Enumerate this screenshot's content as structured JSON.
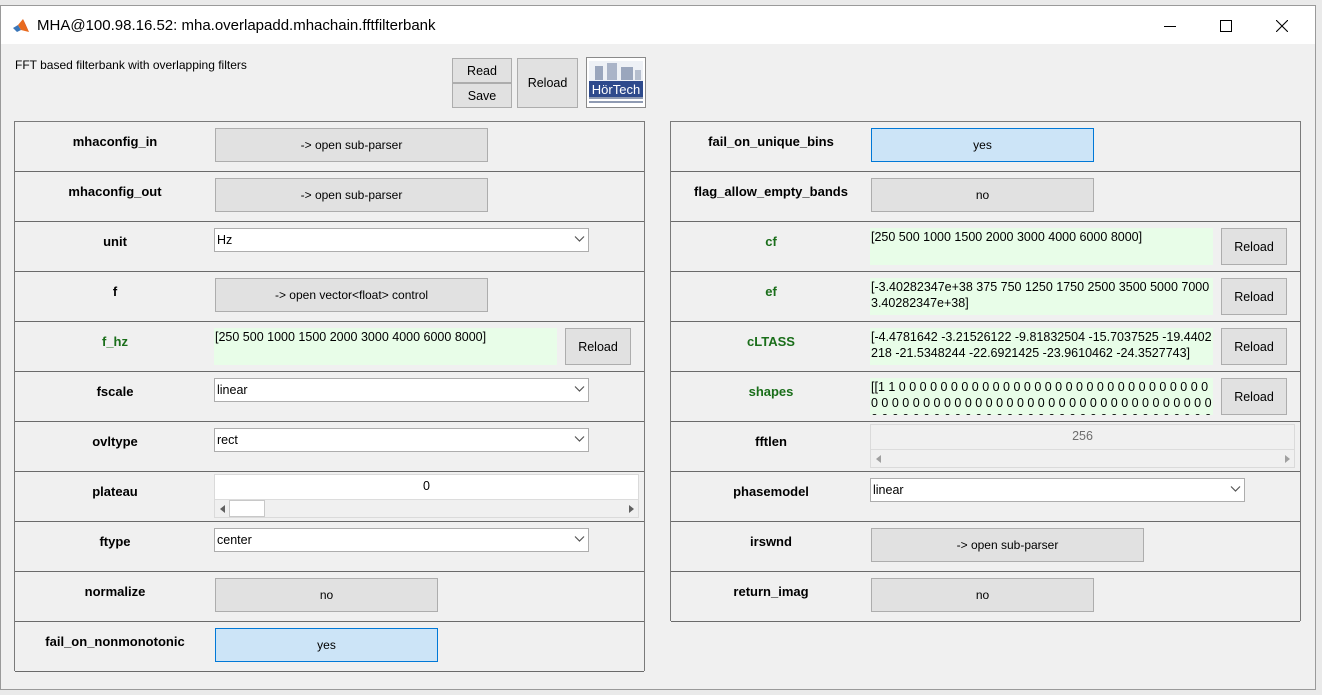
{
  "window": {
    "title": "MHA@100.98.16.52: mha.overlapadd.mhachain.fftfilterbank"
  },
  "header": {
    "description": "FFT based filterbank with overlapping filters",
    "read_label": "Read",
    "save_label": "Save",
    "reload_label": "Reload",
    "logo_text": "HörTech"
  },
  "left": {
    "mhaconfig_in": {
      "label": "mhaconfig_in",
      "button": "-> open sub-parser"
    },
    "mhaconfig_out": {
      "label": "mhaconfig_out",
      "button": "-> open sub-parser"
    },
    "unit": {
      "label": "unit",
      "value": "Hz"
    },
    "f": {
      "label": "f",
      "button": "-> open vector<float> control"
    },
    "f_hz": {
      "label": "f_hz",
      "value": "[250 500 1000 1500 2000 3000 4000 6000 8000]",
      "reload": "Reload"
    },
    "fscale": {
      "label": "fscale",
      "value": "linear"
    },
    "ovltype": {
      "label": "ovltype",
      "value": "rect"
    },
    "plateau": {
      "label": "plateau",
      "value": "0"
    },
    "ftype": {
      "label": "ftype",
      "value": "center"
    },
    "normalize": {
      "label": "normalize",
      "button": "no"
    },
    "fail_on_nonmonotonic": {
      "label": "fail_on_nonmonotonic",
      "button": "yes"
    }
  },
  "right": {
    "fail_on_unique_bins": {
      "label": "fail_on_unique_bins",
      "button": "yes"
    },
    "flag_allow_empty_bands": {
      "label": "flag_allow_empty_bands",
      "button": "no"
    },
    "cf": {
      "label": "cf",
      "value": "[250 500 1000 1500 2000 3000 4000 6000 8000]",
      "reload": "Reload"
    },
    "ef": {
      "label": "ef",
      "value": "[-3.40282347e+38 375 750 1250 1750 2500 3500 5000 7000 3.40282347e+38]",
      "reload": "Reload"
    },
    "cLTASS": {
      "label": "cLTASS",
      "value": "[-4.4781642 -3.21526122 -9.81832504 -15.7037525 -19.4402218 -21.5348244 -22.6921425 -23.9610462 -24.3527743]",
      "reload": "Reload"
    },
    "shapes": {
      "label": "shapes",
      "value": "[[1 1 0 0 0 0 0 0 0 0 0 0 0 0 0 0 0 0 0 0 0 0 0 0 0 0 0 0 0 0 0 0 0 0 0 0 0 0 0 0 0 0 0 0 0 0 0 0 0 0 0 0 0 0 0 0 0 0 0 0 0 0 0 0 0 0 0 0 0 0 0 0 0 0 0 0 0 0 0 0 0 0 0 0 0 0 0 0 0 0 0 0 0 0 0 0 0 0 0 0",
      "reload": "Reload"
    },
    "fftlen": {
      "label": "fftlen",
      "value": "256"
    },
    "phasemodel": {
      "label": "phasemodel",
      "value": "linear"
    },
    "irswnd": {
      "label": "irswnd",
      "button": "-> open sub-parser"
    },
    "return_imag": {
      "label": "return_imag",
      "button": "no"
    }
  },
  "colors": {
    "panel_bg": "#f0f0f0",
    "green_label": "#1a6e1a",
    "text_field_bg": "#e8fde8",
    "toggle_on_bg": "#cce4f7",
    "toggle_on_border": "#0078d7"
  }
}
